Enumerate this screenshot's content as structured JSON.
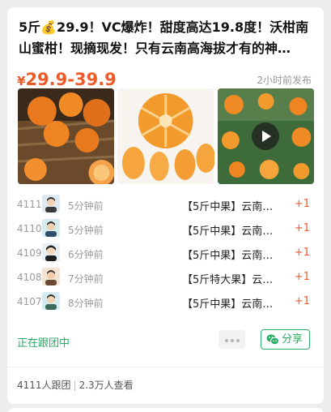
{
  "post": {
    "title": "5斤💰29.9！VC爆炸！甜度高达19.8度！沃柑南山蜜柑！现摘现发！只有云南高海拔才有的神…",
    "price_symbol": "¥",
    "price_range": "29.9-39.9",
    "posted_time": "2小时前发布"
  },
  "photos": [
    {
      "name": "oranges-basket-photo"
    },
    {
      "name": "peeled-mandarin-photo"
    },
    {
      "name": "orchard-video-thumbnail"
    }
  ],
  "orders": [
    {
      "number": "4111",
      "time": "5分钟前",
      "product": "【5斤中果】云南…",
      "quantity": "+1"
    },
    {
      "number": "4110",
      "time": "5分钟前",
      "product": "【5斤中果】云南…",
      "quantity": "+1"
    },
    {
      "number": "4109",
      "time": "6分钟前",
      "product": "【5斤中果】云南…",
      "quantity": "+1"
    },
    {
      "number": "4108",
      "time": "7分钟前",
      "product": "【5斤特大果】云…",
      "quantity": "+1"
    },
    {
      "number": "4107",
      "time": "8分钟前",
      "product": "【5斤中果】云南…",
      "quantity": "+1"
    }
  ],
  "status_text": "正在跟团中",
  "share_label": "分享",
  "footer": {
    "followers": "4111人跟团",
    "views": "2.3万人查看"
  },
  "colors": {
    "price": "#f05a28",
    "accent_green": "#2aae67"
  }
}
